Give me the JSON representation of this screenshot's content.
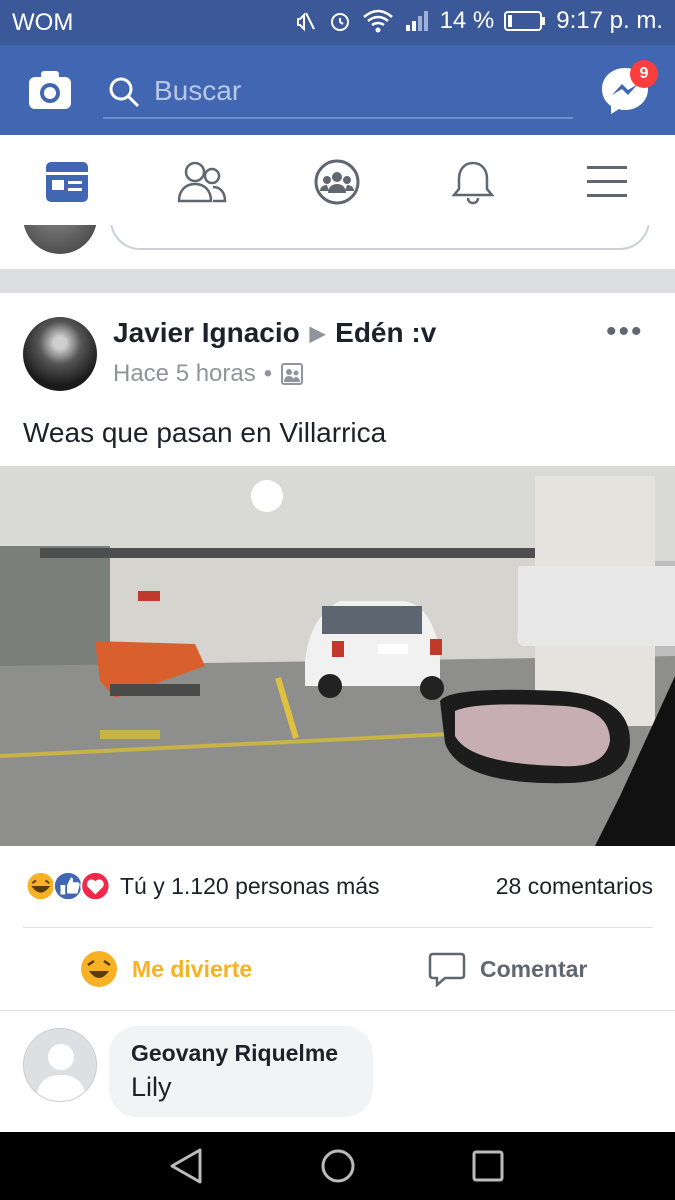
{
  "status_bar": {
    "carrier": "WOM",
    "battery": "14 %",
    "time": "9:17 p. m."
  },
  "top_bar": {
    "search_placeholder": "Buscar",
    "messenger_badge": "9"
  },
  "tabs": [
    {
      "name": "news-feed",
      "icon": "news-feed-icon",
      "active": true
    },
    {
      "name": "friends",
      "icon": "friends-icon"
    },
    {
      "name": "groups",
      "icon": "groups-icon"
    },
    {
      "name": "notifications",
      "icon": "bell-icon"
    },
    {
      "name": "menu",
      "icon": "menu-icon"
    }
  ],
  "post": {
    "author": "Javier Ignacio",
    "target": "Edén :v",
    "time": "Hace 5 horas",
    "text": "Weas que pasan en Villarrica",
    "reactions_summary": "Tú y 1.120 personas más",
    "comments_count": "28 comentarios",
    "reaction_button": "Me divierte",
    "comment_button": "Comentar"
  },
  "comment": {
    "author": "Geovany Riquelme",
    "text": "Lily"
  },
  "colors": {
    "brand": "#4267b2",
    "status": "#3b5998",
    "haha": "#f7b125",
    "badge": "#fa3e3e"
  }
}
